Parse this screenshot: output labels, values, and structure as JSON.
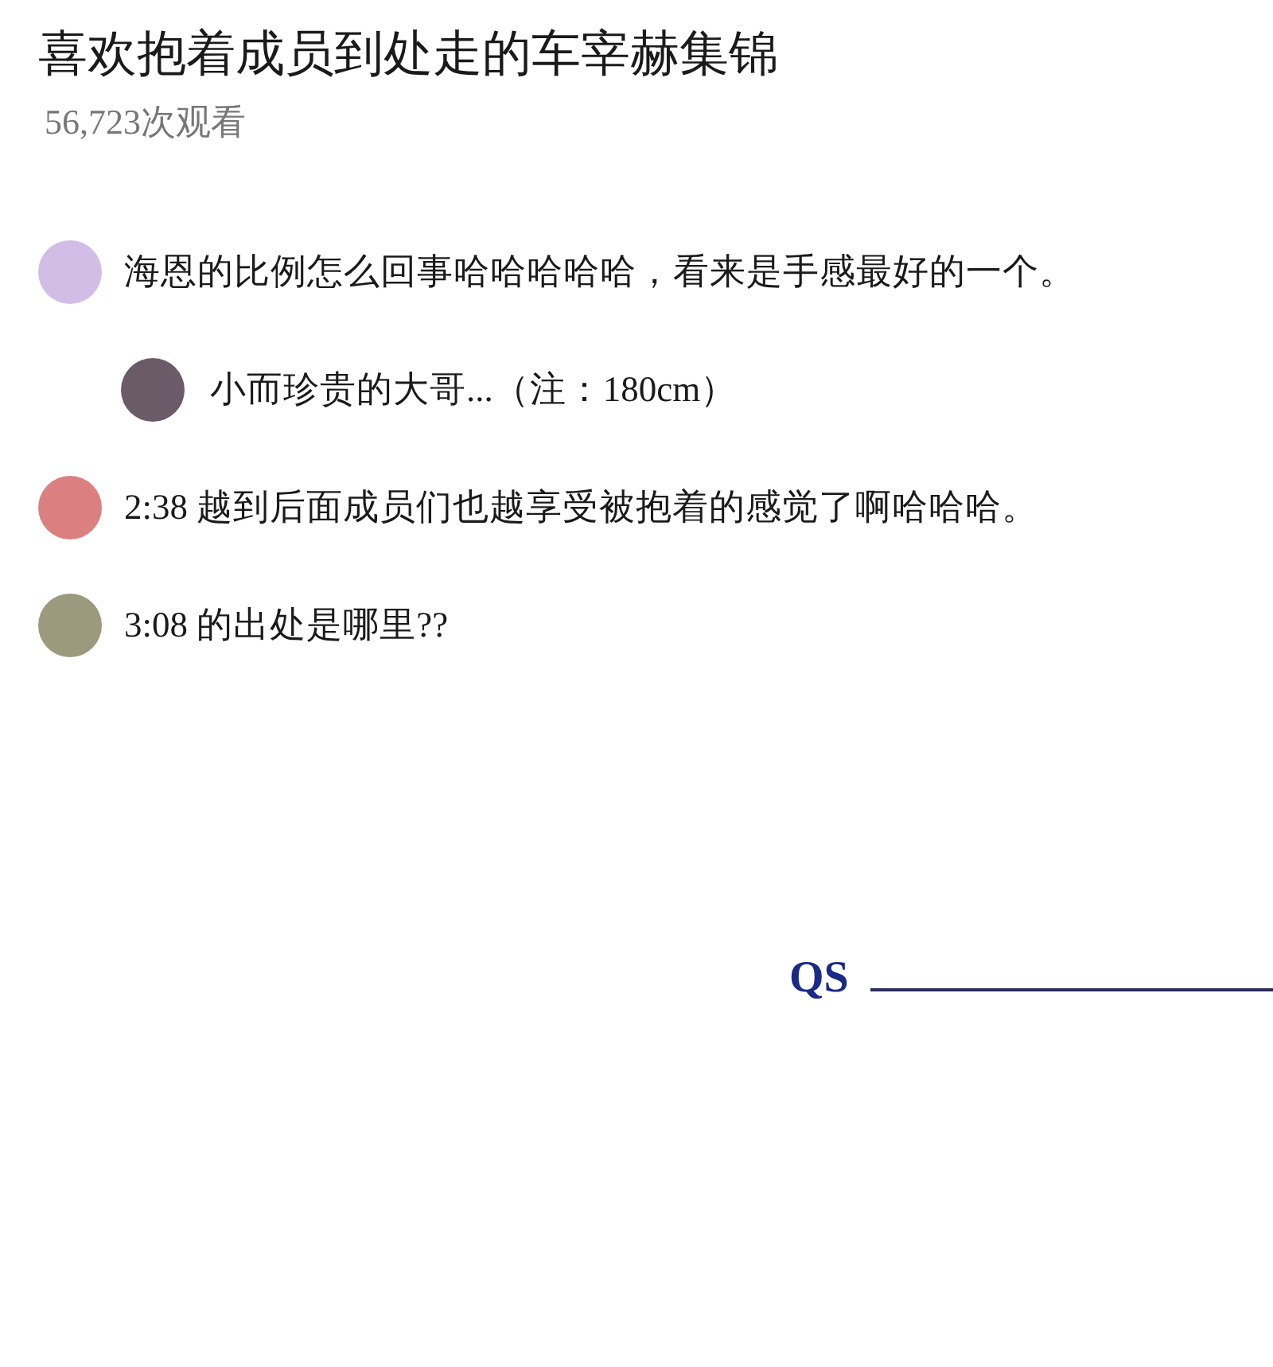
{
  "video": {
    "title": "喜欢抱着成员到处走的车宰赫集锦",
    "views": "56,723次观看"
  },
  "comments": [
    {
      "color": "#d1bde6",
      "text": "海恩的比例怎么回事哈哈哈哈哈，看来是手感最好的一个。",
      "children": [
        {
          "color": "#6b5a68",
          "text": "小而珍贵的大哥...（注：180cm）"
        }
      ]
    },
    {
      "color": "#db8080",
      "text": "2:38 越到后面成员们也越享受被抱着的感觉了啊哈哈哈。"
    },
    {
      "color": "#9b9a7e",
      "text": "3:08 的出处是哪里??"
    }
  ],
  "signature": "QS"
}
